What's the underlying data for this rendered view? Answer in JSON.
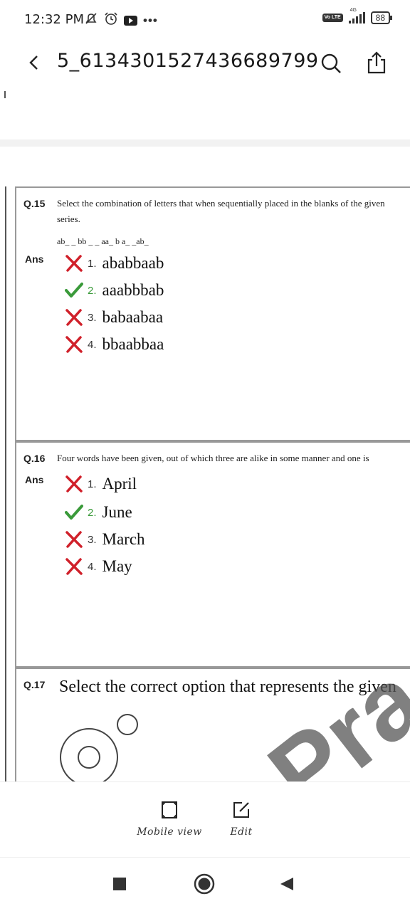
{
  "status_bar": {
    "time": "12:32 PM",
    "network_badge": "Vo LTE",
    "network_type": "4G",
    "battery": "88",
    "icons": [
      "muted-notification-icon",
      "alarm-icon",
      "youtube-icon",
      "more-dots-icon"
    ]
  },
  "app_bar": {
    "title": "5_6134301527436689799",
    "icons": [
      "back-icon",
      "search-icon",
      "share-icon"
    ]
  },
  "questions": [
    {
      "number": "Q.15",
      "text_line1": "Select the combination of letters that when sequentially placed in the blanks of the given",
      "text_line2": "series.",
      "series": "ab_ _ bb _ _ aa_ b a_ _ab_",
      "ans_label": "Ans",
      "options": [
        {
          "num": "1.",
          "text": "ababbaab",
          "status": "wrong"
        },
        {
          "num": "2.",
          "text": "aaabbbab",
          "status": "correct"
        },
        {
          "num": "3.",
          "text": "babaabaa",
          "status": "wrong"
        },
        {
          "num": "4.",
          "text": "bbaabbaa",
          "status": "wrong"
        }
      ]
    },
    {
      "number": "Q.16",
      "text_line1": "Four words have been given, out of which three are alike in some manner and one is",
      "ans_label": "Ans",
      "options": [
        {
          "num": "1.",
          "text": "April",
          "status": "wrong"
        },
        {
          "num": "2.",
          "text": "June",
          "status": "correct"
        },
        {
          "num": "3.",
          "text": "March",
          "status": "wrong"
        },
        {
          "num": "4.",
          "text": "May",
          "status": "wrong"
        }
      ]
    },
    {
      "number": "Q.17",
      "text_line1": "Select the correct option that represents the given"
    }
  ],
  "watermark": "Pra",
  "toolbar": {
    "mobile_view_label": "Mobile view",
    "edit_label": "Edit"
  },
  "colors": {
    "correct": "#3a9a3a",
    "wrong": "#d0202a",
    "box_border": "#999999"
  }
}
